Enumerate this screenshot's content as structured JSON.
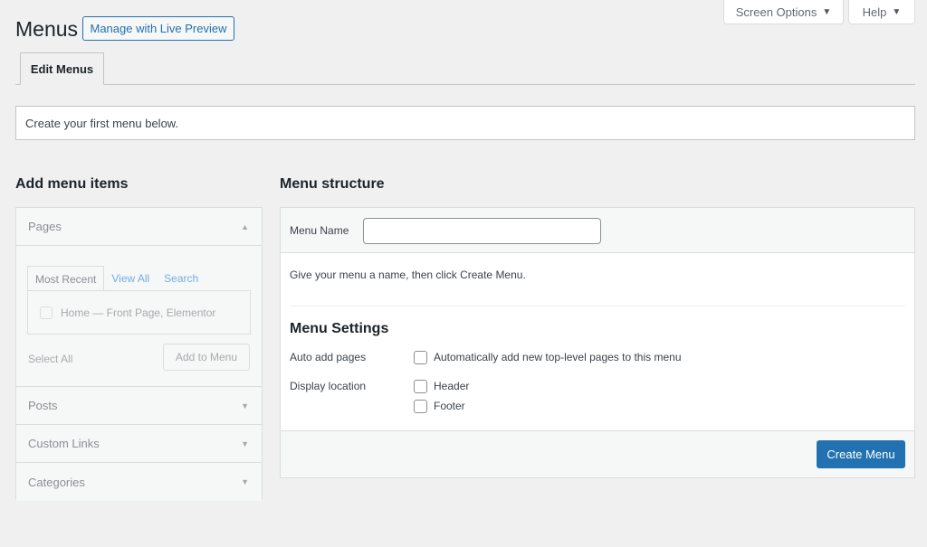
{
  "header": {
    "screen_options_label": "Screen Options",
    "help_label": "Help",
    "dropdown_arrow": "▼",
    "title": "Menus",
    "live_preview_label": "Manage with Live Preview"
  },
  "tabs": {
    "edit_menus": "Edit Menus"
  },
  "notice": {
    "text": "Create your first menu below."
  },
  "add_items": {
    "heading": "Add menu items",
    "sections": [
      {
        "label": "Pages",
        "icon": "triangle-up-icon",
        "expanded": true
      },
      {
        "label": "Posts",
        "icon": "triangle-down-icon"
      },
      {
        "label": "Custom Links",
        "icon": "triangle-down-icon"
      },
      {
        "label": "Categories",
        "icon": "triangle-down-icon"
      }
    ],
    "pages_tabs": [
      "Most Recent",
      "View All",
      "Search"
    ],
    "pages_item": "Home — Front Page, Elementor",
    "select_all": "Select All",
    "add_to_menu": "Add to Menu"
  },
  "structure": {
    "heading": "Menu structure",
    "menu_name_label": "Menu Name",
    "menu_name_value": "",
    "hint": "Give your menu a name, then click Create Menu.",
    "settings_heading": "Menu Settings",
    "auto_add_label": "Auto add pages",
    "auto_add_option": "Automatically add new top-level pages to this menu",
    "display_location_label": "Display location",
    "locations": [
      "Header",
      "Footer"
    ],
    "create_button": "Create Menu"
  },
  "colors": {
    "accent": "#2271b1",
    "background": "#f0f0f1"
  }
}
